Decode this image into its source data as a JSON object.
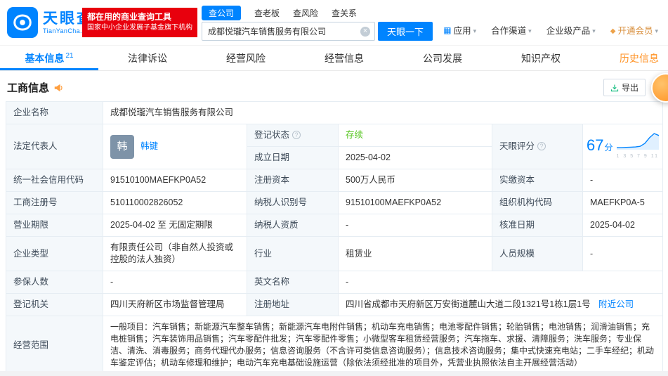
{
  "header": {
    "logo_cn": "天眼查",
    "logo_en": "TianYanCha.com",
    "banner_line1": "都在用的商业查询工具",
    "banner_line2": "国家中小企业发展子基金旗下机构",
    "quick_tabs": {
      "company": "查公司",
      "boss": "查老板",
      "risk": "查风险",
      "relation": "查关系"
    },
    "search": {
      "value": "成都悦瓏汽车销售服务有限公司",
      "button": "天眼一下"
    },
    "menu": {
      "apps": "应用",
      "cooperation": "合作渠道",
      "enterprise": "企业级产品",
      "vip": "开通会员"
    }
  },
  "tabs": {
    "basic": "基本信息",
    "basic_count": "21",
    "legal": "法律诉讼",
    "risk": "经营风险",
    "operation": "经营信息",
    "development": "公司发展",
    "ip": "知识产权",
    "history": "历史信息"
  },
  "section": {
    "title": "工商信息",
    "export_label": "导出"
  },
  "info": {
    "company_name_label": "企业名称",
    "company_name": "成都悦瓏汽车销售服务有限公司",
    "legal_rep_label": "法定代表人",
    "legal_rep_avatar_char": "韩",
    "legal_rep_name": "韩键",
    "reg_status_label": "登记状态",
    "reg_status_value": "存续",
    "establish_date_label": "成立日期",
    "establish_date_value": "2025-04-02",
    "credit_code_label": "统一社会信用代码",
    "credit_code_value": "91510100MAEFKP0A52",
    "reg_capital_label": "注册资本",
    "reg_capital_value": "500万人民币",
    "paid_capital_label": "实缴资本",
    "paid_capital_value": "-",
    "reg_no_label": "工商注册号",
    "reg_no_value": "510110002826052",
    "taxpayer_no_label": "纳税人识别号",
    "taxpayer_no_value": "91510100MAEFKP0A52",
    "org_code_label": "组织机构代码",
    "org_code_value": "MAEFKP0A-5",
    "term_label": "营业期限",
    "term_value": "2025-04-02 至 无固定期限",
    "taxpayer_quality_label": "纳税人资质",
    "taxpayer_quality_value": "-",
    "approve_date_label": "核准日期",
    "approve_date_value": "2025-04-02",
    "company_type_label": "企业类型",
    "company_type_value": "有限责任公司（非自然人投资或控股的法人独资）",
    "industry_label": "行业",
    "industry_value": "租赁业",
    "staff_label": "人员规模",
    "staff_value": "-",
    "insured_label": "参保人数",
    "insured_value": "-",
    "en_name_label": "英文名称",
    "en_name_value": "-",
    "authority_label": "登记机关",
    "authority_value": "四川天府新区市场监督管理局",
    "address_label": "注册地址",
    "address_value": "四川省成都市天府新区万安街道麓山大道二段1321号1栋1层1号",
    "nearby_label": "附近公司",
    "scope_label": "经营范围",
    "scope_value": "一般项目：汽车销售；新能源汽车整车销售；新能源汽车电附件销售；机动车充电销售；电池零配件销售；轮胎销售；电池销售；润滑油销售；充电桩销售；汽车装饰用品销售；汽车零配件批发；汽车零配件零售；小微型客车租赁经营服务；汽车拖车、求援、清障服务；洗车服务；专业保洁、清洗、消毒服务；商务代理代办服务；信息咨询服务（不含许可类信息咨询服务）；信息技术咨询服务；集中式快速充电站；二手车经纪；机动车鉴定评估；机动车修理和维护；电动汽车充电基础设施运营（除依法须经批准的项目外，凭营业执照依法自主开展经营活动）"
  },
  "score": {
    "label": "天眼评分",
    "value": "67",
    "unit": "分",
    "trend": [
      3,
      3,
      4,
      5,
      6,
      9,
      22,
      48,
      67,
      58
    ],
    "ticks": [
      "1",
      "3",
      "5",
      "7",
      "9",
      "11"
    ],
    "line_color": "#0084ff",
    "area_color": "rgba(0,132,255,0.12)"
  }
}
